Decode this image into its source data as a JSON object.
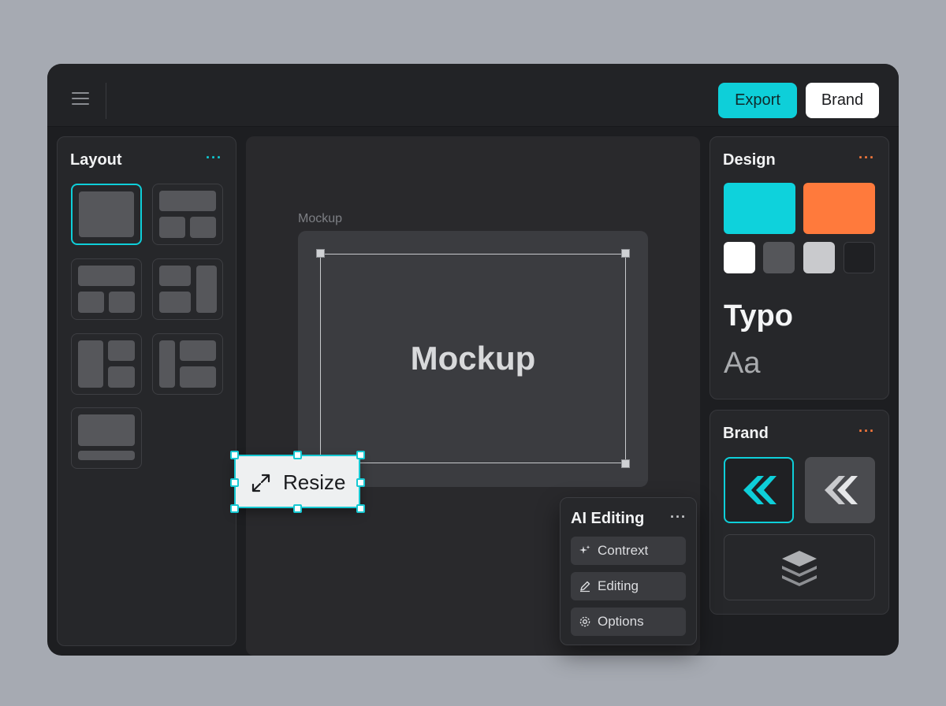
{
  "toolbar": {
    "export_label": "Export",
    "brand_label": "Brand"
  },
  "layout": {
    "title": "Layout",
    "more": "···"
  },
  "canvas": {
    "mockup_label": "Mockup",
    "mockup_text": "Mockup",
    "resize_label": "Resize"
  },
  "ai_editing": {
    "title": "AI Editing",
    "more": "···",
    "items": [
      {
        "label": "Contrext",
        "icon": "sparkle-icon"
      },
      {
        "label": "Editing",
        "icon": "pencil-icon"
      },
      {
        "label": "Options",
        "icon": "gear-icon"
      }
    ]
  },
  "design": {
    "title": "Design",
    "more": "···",
    "typo_heading": "Typo",
    "typo_sample": "Aa",
    "colors": [
      "#0ed2dc",
      "#ff7a3c",
      "#ffffff",
      "#55565a",
      "#c9cacd",
      "#1f2023"
    ]
  },
  "brand": {
    "title": "Brand",
    "more": "···"
  },
  "accent": {
    "cyan": "#0ecfd9",
    "orange": "#ff7a3c"
  }
}
